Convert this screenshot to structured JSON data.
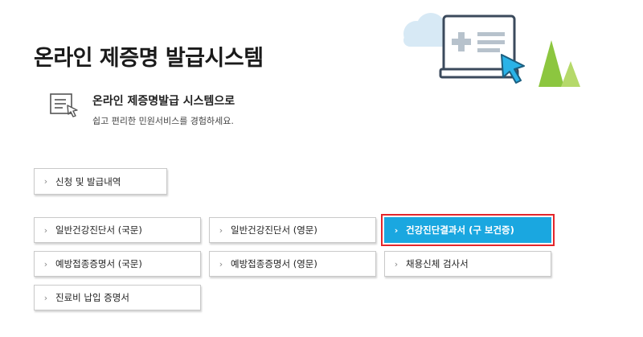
{
  "title": "온라인 제증명 발급시스템",
  "intro": {
    "heading": "온라인 제증명발급 시스템으로",
    "subtext": "쉽고 편리한 민원서비스를 경험하세요."
  },
  "buttons": {
    "history": "신청 및 발급내역",
    "health_ko": "일반건강진단서 (국문)",
    "health_en": "일반건강진단서 (영문)",
    "checkup_result": "건강진단결과서 (구 보건증)",
    "vaccine_ko": "예방접종증명서 (국문)",
    "vaccine_en": "예방접종증명서 (영문)",
    "employment": "채용신체 검사서",
    "payment": "진료비 납입 증명서"
  },
  "colors": {
    "accent": "#1aa7e0",
    "highlight_border": "#e3262b",
    "cloud": "#d7e9f5",
    "tree": "#8cc63f"
  },
  "icons": {
    "intro": "document-pointer-icon",
    "chevron": "chevron-right-icon",
    "hero": "computer-monitor-cursor-icon"
  }
}
